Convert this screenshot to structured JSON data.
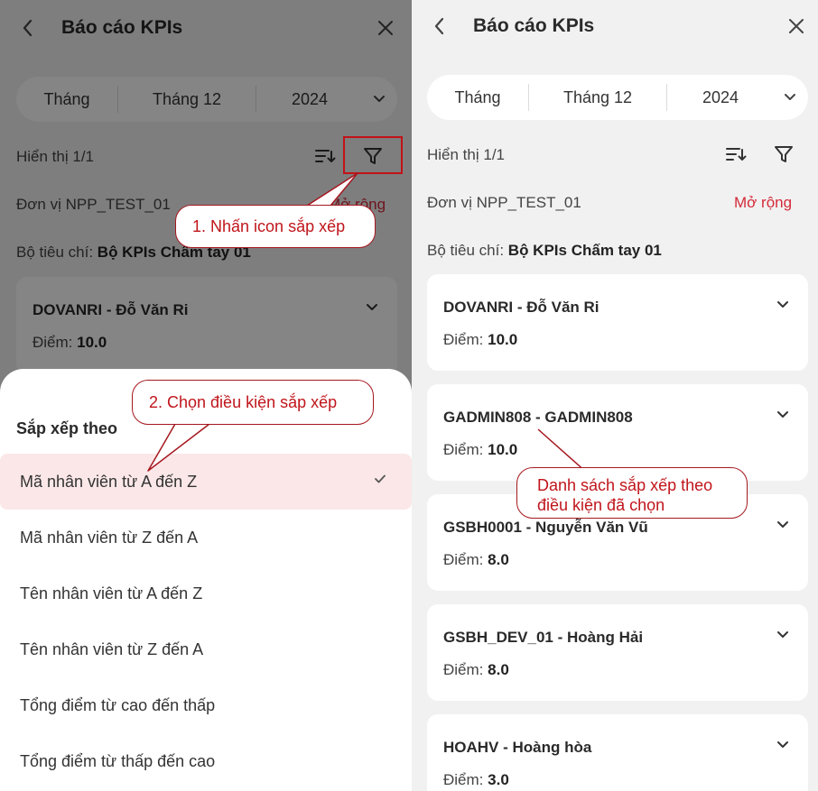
{
  "left_screen": {
    "header": {
      "title": "Báo cáo KPIs"
    },
    "period": {
      "type": "Tháng",
      "month": "Tháng 12",
      "year": "2024"
    },
    "display_count": "Hiển thị 1/1",
    "unit": "Đơn vị NPP_TEST_01",
    "expand_label": "Mở rộng",
    "criteria_label": "Bộ tiêu chí:",
    "criteria_value": "Bộ KPIs Chấm tay 01",
    "card": {
      "name": "DOVANRI - Đỗ Văn Ri",
      "score_label": "Điểm:",
      "score": "10.0"
    },
    "sort_sheet": {
      "title": "Sắp xếp theo",
      "options": [
        {
          "label": "Mã nhân viên từ A đến Z",
          "selected": true
        },
        {
          "label": "Mã nhân viên từ Z đến A",
          "selected": false
        },
        {
          "label": "Tên nhân viên từ A đến Z",
          "selected": false
        },
        {
          "label": "Tên nhân viên từ Z đến A",
          "selected": false
        },
        {
          "label": "Tổng điểm từ cao đến thấp",
          "selected": false
        },
        {
          "label": "Tổng điểm từ thấp đến cao",
          "selected": false
        }
      ]
    }
  },
  "right_screen": {
    "header": {
      "title": "Báo cáo KPIs"
    },
    "period": {
      "type": "Tháng",
      "month": "Tháng 12",
      "year": "2024"
    },
    "display_count": "Hiển thị 1/1",
    "unit": "Đơn vị NPP_TEST_01",
    "expand_label": "Mở rộng",
    "criteria_label": "Bộ tiêu chí:",
    "criteria_value": "Bộ KPIs Chấm tay 01",
    "cards": [
      {
        "name": "DOVANRI - Đỗ Văn Ri",
        "score_label": "Điểm:",
        "score": "10.0"
      },
      {
        "name": "GADMIN808 - GADMIN808",
        "score_label": "Điểm:",
        "score": "10.0"
      },
      {
        "name": "GSBH0001 - Nguyễn Văn Vũ",
        "score_label": "Điểm:",
        "score": "8.0"
      },
      {
        "name": "GSBH_DEV_01 - Hoàng Hải",
        "score_label": "Điểm:",
        "score": "8.0"
      },
      {
        "name": "HOAHV - Hoàng hòa",
        "score_label": "Điểm:",
        "score": "3.0"
      }
    ]
  },
  "annotations": {
    "step1": "1. Nhấn icon sắp xếp",
    "step2": "2. Chọn điều kiện sắp xếp",
    "result_line1": "Danh sách sắp xếp theo",
    "result_line2": "điều kiện đã chọn"
  },
  "colors": {
    "accent_red": "#d42a3a",
    "callout_border": "#a5181f",
    "selected_row_bg": "#fbe7e8",
    "screen_bg": "#f1f1f1"
  },
  "icons": [
    "back-arrow-icon",
    "close-icon",
    "chevron-down-icon",
    "sort-list-icon",
    "filter-funnel-icon",
    "check-icon"
  ]
}
